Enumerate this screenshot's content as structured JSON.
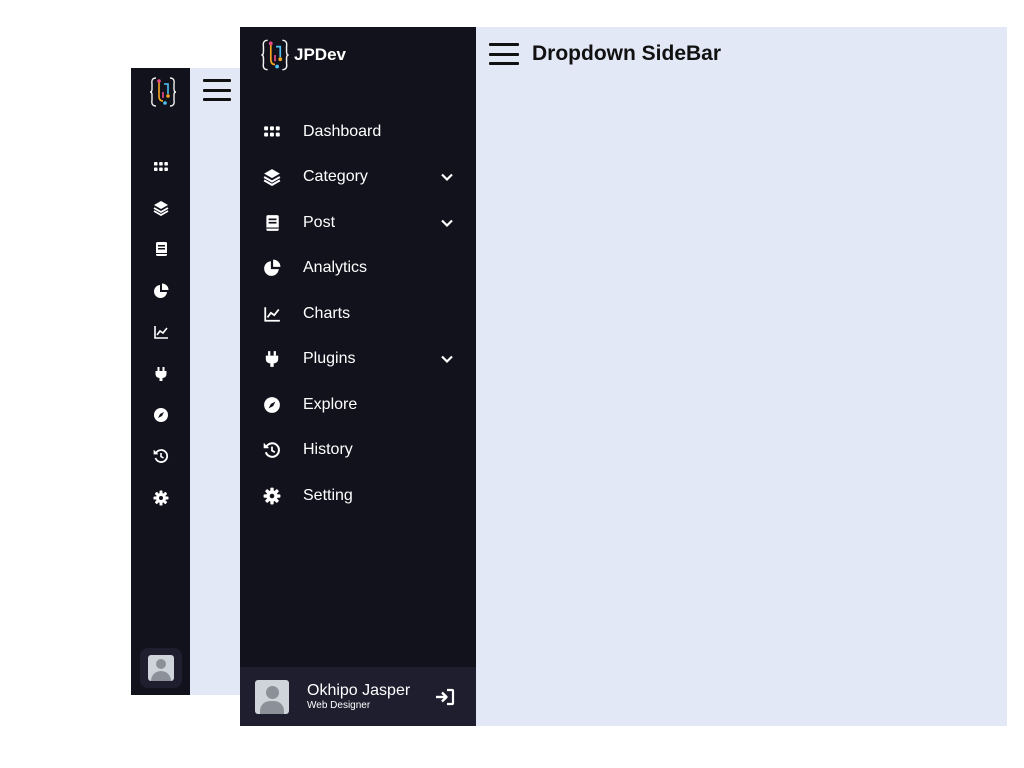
{
  "app": {
    "brand_name": "JPDev",
    "page_title": "Dropdown SideBar"
  },
  "colors": {
    "sidebar_bg": "#12121d",
    "profile_bg": "#1e1e2f",
    "content_bg": "#e3e8f6",
    "text_light": "#ffffff",
    "text_dark": "#111111"
  },
  "sidebar": {
    "items": [
      {
        "label": "Dashboard",
        "icon": "grid-icon",
        "has_dropdown": false
      },
      {
        "label": "Category",
        "icon": "layers-icon",
        "has_dropdown": true
      },
      {
        "label": "Post",
        "icon": "book-icon",
        "has_dropdown": true
      },
      {
        "label": "Analytics",
        "icon": "pie-chart-icon",
        "has_dropdown": false
      },
      {
        "label": "Charts",
        "icon": "line-chart-icon",
        "has_dropdown": false
      },
      {
        "label": "Plugins",
        "icon": "plug-icon",
        "has_dropdown": true
      },
      {
        "label": "Explore",
        "icon": "compass-icon",
        "has_dropdown": false
      },
      {
        "label": "History",
        "icon": "history-icon",
        "has_dropdown": false
      },
      {
        "label": "Setting",
        "icon": "gear-icon",
        "has_dropdown": false
      }
    ]
  },
  "profile": {
    "name": "Okhipo Jasper",
    "role": "Web Designer"
  }
}
